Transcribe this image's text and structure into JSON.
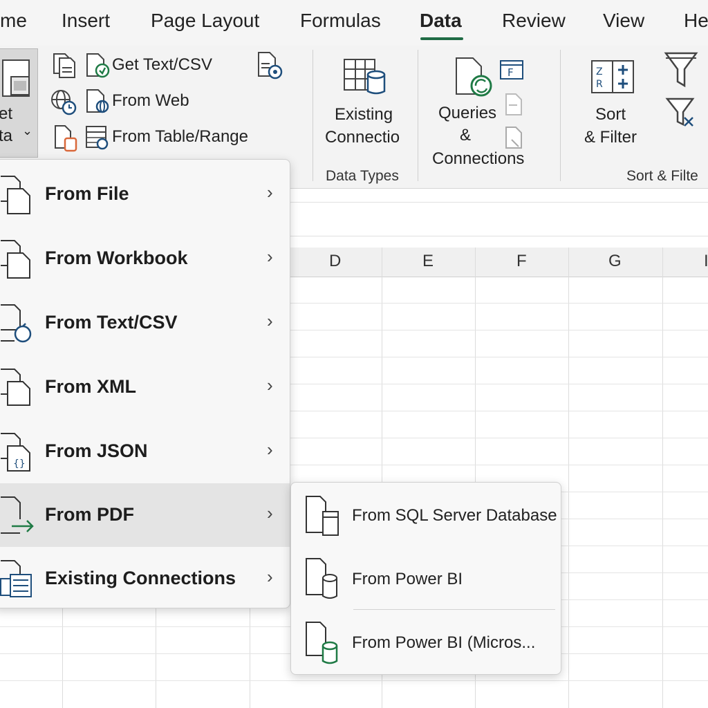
{
  "tabs": [
    "me",
    "Insert",
    "Page Layout",
    "Formulas",
    "Data",
    "Review",
    "View",
    "He"
  ],
  "active_tab": "Data",
  "colors": {
    "accent": "#1f6b45",
    "icon_blue": "#1e4e7c",
    "icon_green": "#1f7a45",
    "icon_orange": "#d9683a"
  },
  "ribbon": {
    "get_data": {
      "line1": "et",
      "line2": "ta",
      "chevron": "⌄"
    },
    "get_text_csv": "Get Text/CSV",
    "from_web": "From Web",
    "from_table_range": "From Table/Range",
    "existing_connections": {
      "line1": "Existing",
      "line2": "Connectio"
    },
    "data_types_label": "Data Types",
    "queries": {
      "line1": "Queries",
      "line2": "&",
      "line3": "Connections"
    },
    "sort_filter": {
      "line1": "Sort",
      "line2": "& Filter"
    },
    "sort_filter_group": "Sort & Filte"
  },
  "columns": [
    "D",
    "E",
    "F",
    "G",
    "I"
  ],
  "menu": {
    "items": [
      {
        "label": "From File",
        "chevron": "›"
      },
      {
        "label": "From Workbook",
        "chevron": "›"
      },
      {
        "label": "From Text/CSV",
        "chevron": "›"
      },
      {
        "label": "From XML",
        "chevron": "›"
      },
      {
        "label": "From JSON",
        "chevron": "›"
      },
      {
        "label": "From PDF",
        "chevron": "›"
      },
      {
        "label": "Existing Connections",
        "chevron": "›"
      }
    ]
  },
  "submenu": {
    "items": [
      {
        "label": "From SQL Server Database"
      },
      {
        "label": "From Power BI"
      },
      {
        "label": "From Power BI (Micros..."
      }
    ]
  }
}
